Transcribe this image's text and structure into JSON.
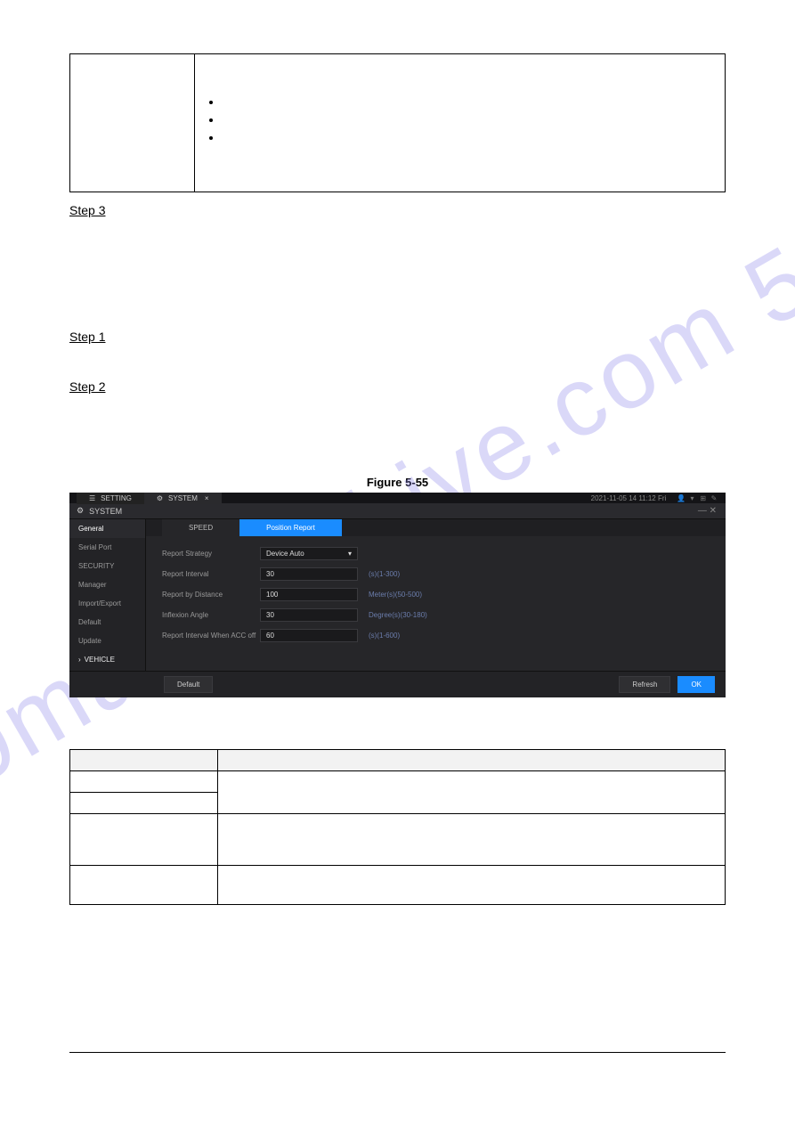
{
  "top_table": {
    "c1": "",
    "bullets": [
      "",
      "",
      ""
    ]
  },
  "steps": {
    "s3": "Step 3",
    "s1": "Step 1",
    "s2": "Step 2"
  },
  "figure_caption": "Figure 5-55",
  "ui": {
    "topbar": {
      "tab1": "SETTING",
      "tab2": "SYSTEM",
      "datetime": "2021-11-05 14 11:12 Fri",
      "icons": [
        "⚙",
        "⛭",
        "⊞",
        "✎"
      ]
    },
    "winbar": {
      "title": "SYSTEM",
      "right": "— ✕"
    },
    "sidebar": [
      "General",
      "Serial Port",
      "SECURITY",
      "Manager",
      "Import/Export",
      "Default",
      "Update",
      "VEHICLE"
    ],
    "sidebar_selected": 0,
    "subtabs": {
      "a": "SPEED",
      "b": "Position Report"
    },
    "form": {
      "f1_label": "Report Strategy",
      "f1_value": "Device Auto",
      "f2_label": "Report Interval",
      "f2_value": "30",
      "f2_hint": "(s)(1-300)",
      "f3_label": "Report by Distance",
      "f3_value": "100",
      "f3_hint": "Meter(s)(50-500)",
      "f4_label": "Inflexion Angle",
      "f4_value": "30",
      "f4_hint": "Degree(s)(30-180)",
      "f5_label": "Report Interval When ACC off",
      "f5_value": "60",
      "f5_hint": "(s)(1-600)"
    },
    "footer": {
      "default": "Default",
      "refresh": "Refresh",
      "ok": "OK"
    }
  },
  "param_table": {
    "h1": "",
    "h2": "",
    "rows": [
      {
        "a": "",
        "b": ""
      },
      {
        "a": "",
        "b": ""
      },
      {
        "a": "",
        "b": ""
      },
      {
        "a": "",
        "b": ""
      }
    ]
  }
}
